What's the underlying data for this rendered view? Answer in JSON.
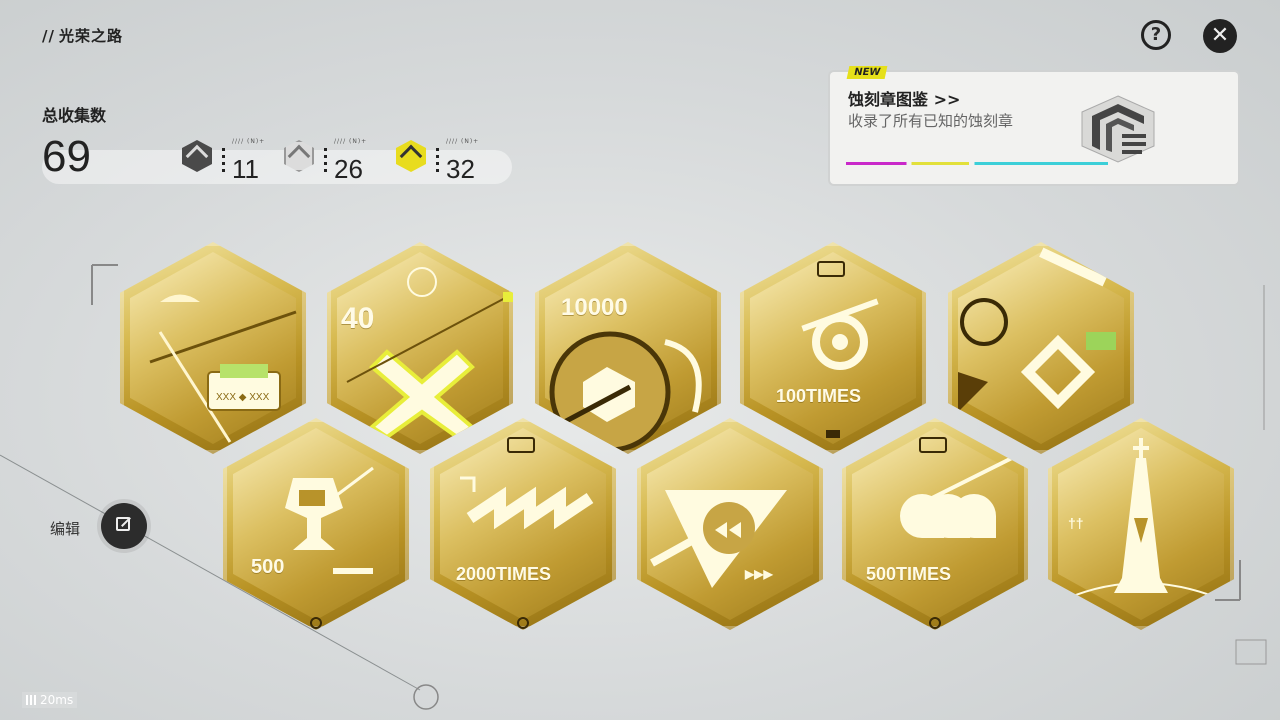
{
  "header": {
    "title": "光荣之路",
    "title_prefix": "//",
    "help_icon": "question-icon",
    "close_icon": "close-icon"
  },
  "stats": {
    "label": "总收集数",
    "total": "69",
    "tiers": [
      {
        "name": "dark",
        "color": "#4a4a4a",
        "count": "11"
      },
      {
        "name": "silver",
        "color": "#e6e6e6",
        "count": "26"
      },
      {
        "name": "gold",
        "color": "#e8dc1e",
        "count": "32"
      }
    ]
  },
  "catalog": {
    "badge": "NEW",
    "title": "蚀刻章图鉴 >>",
    "subtitle": "收录了所有已知的蚀刻章"
  },
  "badges_row1": [
    {
      "id": "b1",
      "text": ""
    },
    {
      "id": "b2",
      "text": "40"
    },
    {
      "id": "b3",
      "text": "10000"
    },
    {
      "id": "b4",
      "text": "100TIMES"
    },
    {
      "id": "b5",
      "text": ""
    }
  ],
  "badges_row2": [
    {
      "id": "b6",
      "text": "500"
    },
    {
      "id": "b7",
      "text": "2000TIMES"
    },
    {
      "id": "b8",
      "text": ""
    },
    {
      "id": "b9",
      "text": "500TIMES"
    },
    {
      "id": "b10",
      "text": ""
    }
  ],
  "edit": {
    "label": "编辑"
  },
  "ping": "20ms",
  "colors": {
    "accent": "#e6e01a",
    "gold": "#c9a43a"
  }
}
